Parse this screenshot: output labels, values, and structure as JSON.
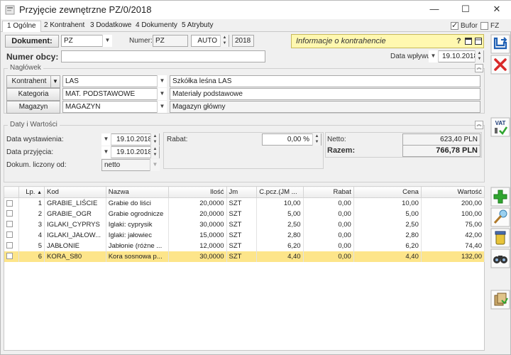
{
  "window": {
    "title": "Przyjęcie zewnętrzne PZ/0/2018",
    "minimize": "—",
    "maximize": "☐",
    "close": "✕"
  },
  "tabs": [
    {
      "label": "1 Ogólne"
    },
    {
      "label": "2 Kontrahent"
    },
    {
      "label": "3 Dodatkowe"
    },
    {
      "label": "4 Dokumenty"
    },
    {
      "label": "5 Atrybuty"
    }
  ],
  "flags": {
    "bufor_label": "Bufor",
    "bufor_checked": true,
    "fz_label": "FZ",
    "fz_checked": false
  },
  "document": {
    "button_label": "Dokument:",
    "type_value": "PZ",
    "numer_label": "Numer:",
    "numer_prefix": "PZ",
    "numer_auto": "AUTO",
    "numer_year": "2018",
    "numer_obcy_label": "Numer obcy:",
    "numer_obcy_value": "",
    "data_wplywu_label": "Data wpływu:",
    "data_wplywu_value": "19.10.2018"
  },
  "info": {
    "text": "Informacje o kontrahencie",
    "help": "?"
  },
  "naglowek": {
    "title": "Nagłówek",
    "kontrahent_button": "Kontrahent",
    "kontrahent_code": "LAS",
    "kontrahent_name": "Szkółka leśna LAS",
    "kategoria_button": "Kategoria",
    "kategoria_code": "MAT. PODSTAWOWE",
    "kategoria_name": "Materiały podstawowe",
    "magazyn_button": "Magazyn",
    "magazyn_code": "MAGAZYN",
    "magazyn_name": "Magazyn główny"
  },
  "daty": {
    "title": "Daty i Wartości",
    "wystawienia_label": "Data wystawienia:",
    "wystawienia_value": "19.10.2018",
    "przyjecia_label": "Data przyjęcia:",
    "przyjecia_value": "19.10.2018",
    "liczony_label": "Dokum. liczony od:",
    "liczony_value": "netto",
    "rabat_label": "Rabat:",
    "rabat_value": "0,00 %",
    "netto_label": "Netto:",
    "netto_value": "623,40 PLN",
    "razem_label": "Razem:",
    "razem_value": "766,78 PLN"
  },
  "grid": {
    "headers": [
      "",
      "Lp.",
      "Kod",
      "Nazwa",
      "Ilość",
      "Jm",
      "C.pcz.(JM ...",
      "Rabat",
      "Cena",
      "Wartość"
    ],
    "rows": [
      {
        "lp": "1",
        "kod": "GRABIE_LIŚCIE",
        "nazwa": "Grabie do liści",
        "ilosc": "20,0000",
        "jm": "SZT",
        "cpcz": "10,00",
        "rabat": "0,00",
        "cena": "10,00",
        "wartosc": "200,00"
      },
      {
        "lp": "2",
        "kod": "GRABIE_OGR",
        "nazwa": "Grabie ogrodnicze",
        "ilosc": "20,0000",
        "jm": "SZT",
        "cpcz": "5,00",
        "rabat": "0,00",
        "cena": "5,00",
        "wartosc": "100,00"
      },
      {
        "lp": "3",
        "kod": "IGLAKI_CYPRYS",
        "nazwa": "Iglaki: cyprysik",
        "ilosc": "30,0000",
        "jm": "SZT",
        "cpcz": "2,50",
        "rabat": "0,00",
        "cena": "2,50",
        "wartosc": "75,00"
      },
      {
        "lp": "4",
        "kod": "IGLAKI_JAŁOW...",
        "nazwa": "Iglaki: jałowiec",
        "ilosc": "15,0000",
        "jm": "SZT",
        "cpcz": "2,80",
        "rabat": "0,00",
        "cena": "2,80",
        "wartosc": "42,00"
      },
      {
        "lp": "5",
        "kod": "JABŁONIE",
        "nazwa": "Jabłonie (różne ...",
        "ilosc": "12,0000",
        "jm": "SZT",
        "cpcz": "6,20",
        "rabat": "0,00",
        "cena": "6,20",
        "wartosc": "74,40"
      },
      {
        "lp": "6",
        "kod": "KORA_S80",
        "nazwa": "Kora sosnowa p...",
        "ilosc": "30,0000",
        "jm": "SZT",
        "cpcz": "4,40",
        "rabat": "0,00",
        "cena": "4,40",
        "wartosc": "132,00",
        "selected": true
      }
    ]
  },
  "side_buttons": {
    "vat_label": "VAT"
  },
  "colors": {
    "info_bg": "#fff8b0",
    "selected_row": "#fde58a",
    "save_blue": "#1e5fb4",
    "delete_red": "#d92a2a",
    "add_green": "#2fa52f"
  }
}
